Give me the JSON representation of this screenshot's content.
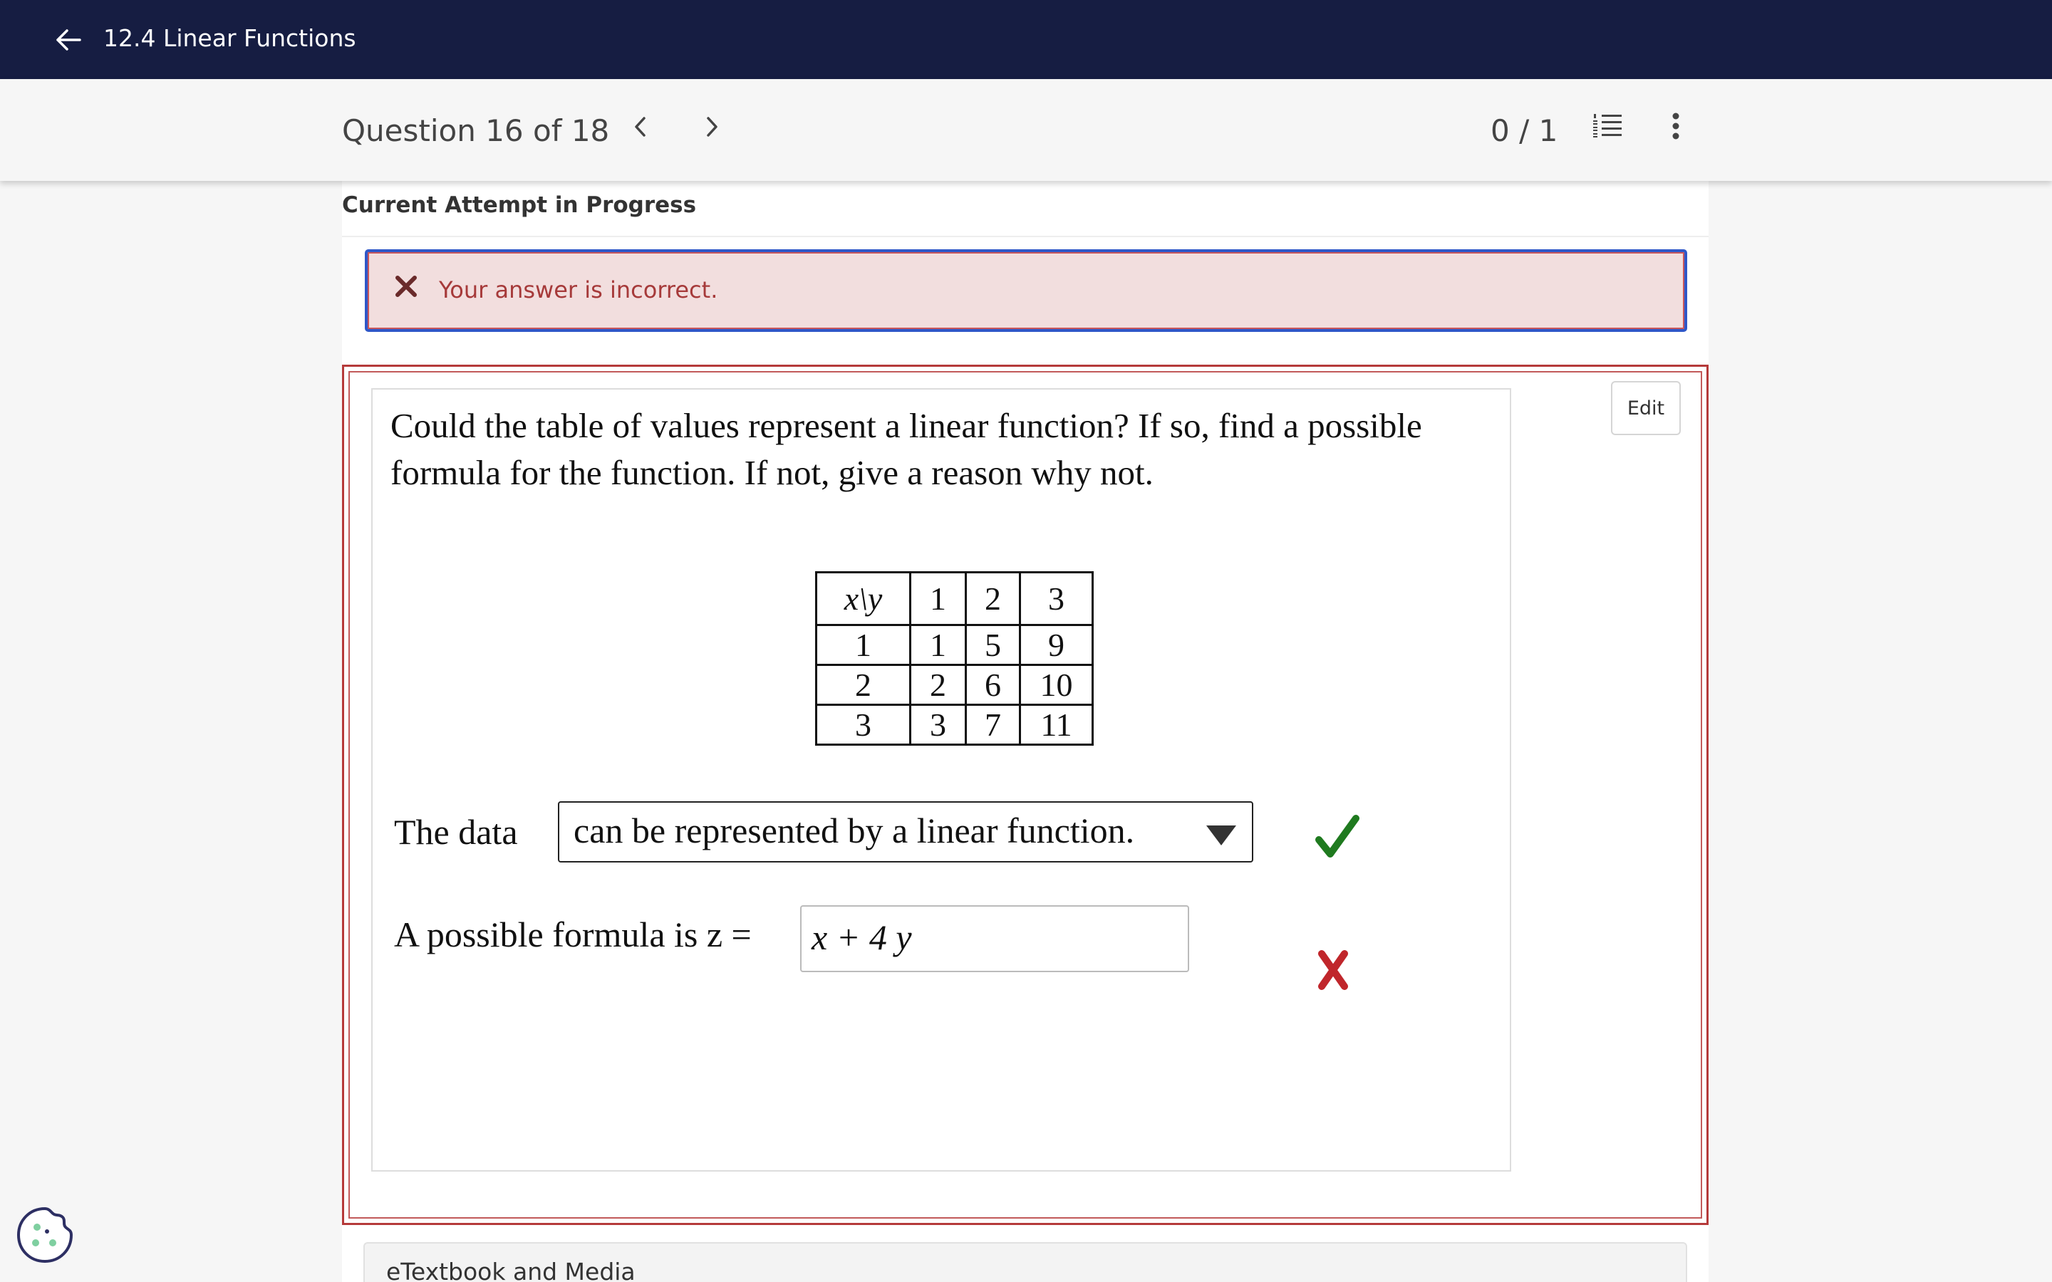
{
  "header": {
    "title": "12.4 Linear Functions"
  },
  "question_bar": {
    "counter": "Question 16 of 18",
    "score": "0 / 1"
  },
  "attempt": {
    "label": "Current Attempt in Progress"
  },
  "feedback": {
    "message": "Your answer is incorrect."
  },
  "question": {
    "edit_label": "Edit",
    "prompt": "Could the table of values represent a linear function? If so, find a possible formula for the function. If not, give a reason why not.",
    "table": {
      "corner": "x\\y",
      "header": [
        "1",
        "2",
        "3"
      ],
      "rows": [
        {
          "x": "1",
          "values": [
            "1",
            "5",
            "9"
          ]
        },
        {
          "x": "2",
          "values": [
            "2",
            "6",
            "10"
          ]
        },
        {
          "x": "3",
          "values": [
            "3",
            "7",
            "11"
          ]
        }
      ]
    },
    "data_label": "The data",
    "data_dropdown_value": "can be represented by a linear function.",
    "formula_label": "A possible formula is z =",
    "formula_value": "x + 4 y",
    "dropdown_status": "correct",
    "formula_status": "incorrect"
  },
  "bottom_card": {
    "title": "eTextbook and Media"
  },
  "colors": {
    "topbar": "#161d42",
    "correct": "#1f7a1f",
    "incorrect": "#c0262b",
    "feedback_bg": "#f2dede"
  }
}
